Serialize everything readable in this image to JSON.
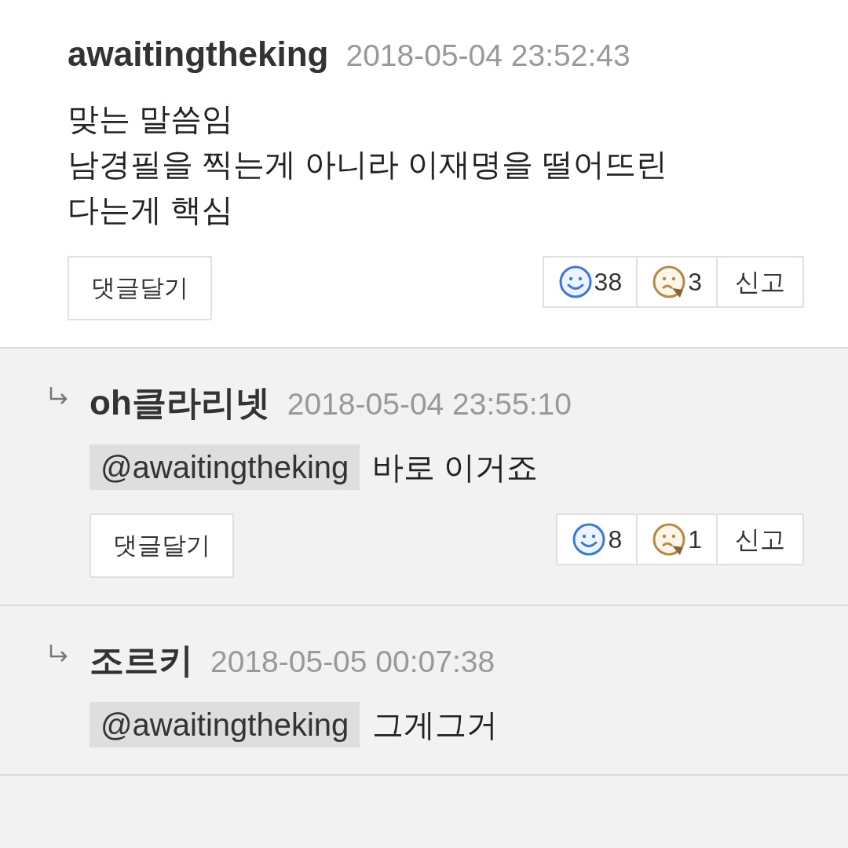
{
  "comments": [
    {
      "kind": "comment",
      "author": "awaitingtheking",
      "date": "2018-05-04 23:52:43",
      "lines": [
        "맞는 말씀임",
        "남경필을 찍는게 아니라 이재명을 떨어뜨린",
        "다는게 핵심"
      ],
      "actions": {
        "reply": "댓글달기",
        "likes": "38",
        "dislikes": "3",
        "report": "신고"
      }
    },
    {
      "kind": "reply",
      "author": "oh클라리넷",
      "date": "2018-05-04 23:55:10",
      "mention": "@awaitingtheking",
      "lines": [
        "바로 이거죠"
      ],
      "actions": {
        "reply": "댓글달기",
        "likes": "8",
        "dislikes": "1",
        "report": "신고"
      }
    },
    {
      "kind": "reply",
      "author": "조르키",
      "date": "2018-05-05 00:07:38",
      "mention": "@awaitingtheking",
      "lines": [
        "그게그거"
      ]
    }
  ]
}
